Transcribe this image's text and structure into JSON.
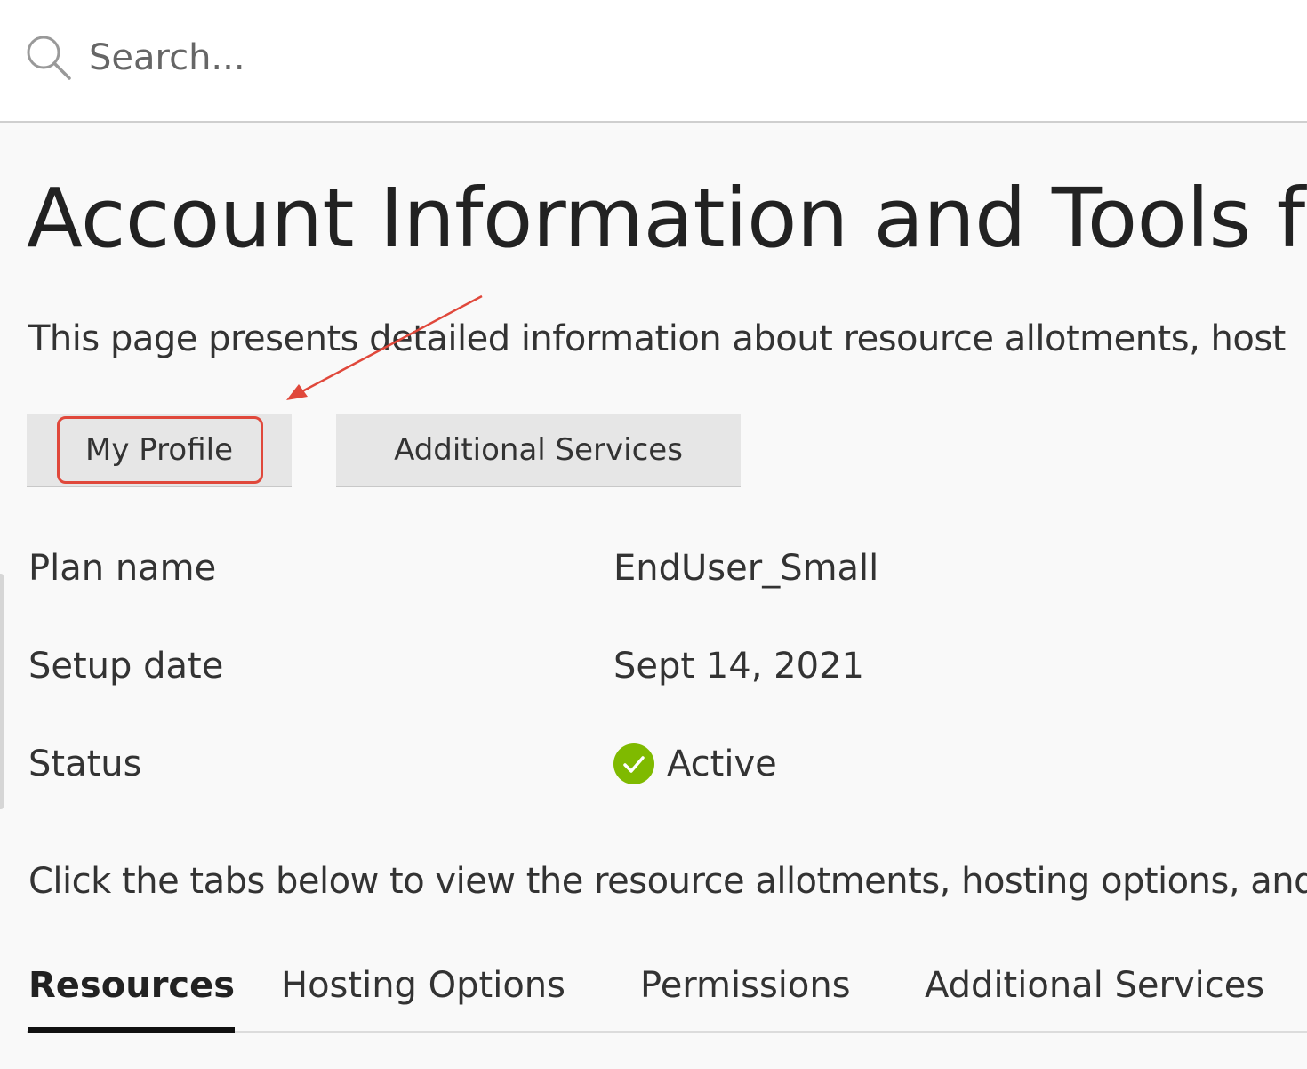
{
  "search": {
    "placeholder": "Search..."
  },
  "page": {
    "title": "Account Information and Tools f",
    "intro": "This page presents detailed information about resource allotments, host"
  },
  "buttons": {
    "profile_label": "My Profile",
    "services_label": "Additional Services"
  },
  "info": {
    "plan_label": "Plan name",
    "plan_value": "EndUser_Small",
    "setup_label": "Setup date",
    "setup_value": "Sept 14, 2021",
    "status_label": "Status",
    "status_value": "Active"
  },
  "tabs_hint": "Click the tabs below to view the resource allotments, hosting options, and",
  "tabs": [
    {
      "label": "Resources",
      "active": true
    },
    {
      "label": "Hosting Options",
      "active": false
    },
    {
      "label": "Permissions",
      "active": false
    },
    {
      "label": "Additional Services",
      "active": false
    }
  ],
  "colors": {
    "highlight": "#e0483b",
    "status_ok": "#7fba00",
    "button_bg": "#e6e6e6"
  },
  "icons": [
    "search-icon",
    "check-circle-icon",
    "annotation-arrow"
  ]
}
